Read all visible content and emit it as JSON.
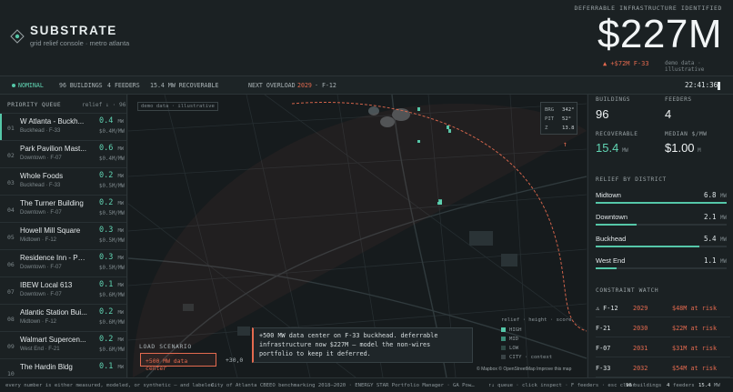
{
  "header": {
    "title": "SUBSTRATE",
    "subtitle": "grid relief console · metro atlanta",
    "hero_label": "DEFERRABLE INFRASTRUCTURE IDENTIFIED",
    "hero_value": "$227M",
    "hero_delta": "▲ +$72M F-33",
    "hero_note": "demo data · illustrative"
  },
  "status": {
    "state": "NOMINAL",
    "buildings": "96 BUILDINGS",
    "feeders": "4 FEEDERS",
    "recoverable": "15.4 MW RECOVERABLE",
    "next_overload_label": "NEXT OVERLOAD",
    "next_overload_year": "2029",
    "next_overload_feeder": "· F-12",
    "clock": "22:41:36"
  },
  "queue": {
    "title": "PRIORITY QUEUE",
    "meta": "relief ↓ · 96",
    "rows": [
      {
        "idx": "01",
        "name": "W Atlanta - Buckh...",
        "sub": "Buckhead · F-33",
        "val": "0.4",
        "unit": "MW",
        "rate": "$0.4M/MW"
      },
      {
        "idx": "02",
        "name": "Park Pavilion Mast...",
        "sub": "Downtown · F-07",
        "val": "0.6",
        "unit": "MW",
        "rate": "$0.4M/MW"
      },
      {
        "idx": "03",
        "name": "Whole Foods",
        "sub": "Buckhead · F-33",
        "val": "0.2",
        "unit": "MW",
        "rate": "$0.5M/MW"
      },
      {
        "idx": "04",
        "name": "The Turner Building",
        "sub": "Downtown · F-07",
        "val": "0.2",
        "unit": "MW",
        "rate": "$0.5M/MW"
      },
      {
        "idx": "05",
        "name": "Howell Mill Square",
        "sub": "Midtown · F-12",
        "val": "0.3",
        "unit": "MW",
        "rate": "$0.5M/MW"
      },
      {
        "idx": "06",
        "name": "Residence Inn - Pe...",
        "sub": "Downtown · F-07",
        "val": "0.3",
        "unit": "MW",
        "rate": "$0.5M/MW"
      },
      {
        "idx": "07",
        "name": "IBEW Local 613",
        "sub": "Downtown · F-07",
        "val": "0.1",
        "unit": "MW",
        "rate": "$0.6M/MW"
      },
      {
        "idx": "08",
        "name": "Atlantic Station Bui...",
        "sub": "Midtown · F-12",
        "val": "0.2",
        "unit": "MW",
        "rate": "$0.6M/MW"
      },
      {
        "idx": "09",
        "name": "Walmart Supercen...",
        "sub": "West End · F-21",
        "val": "0.2",
        "unit": "MW",
        "rate": "$0.6M/MW"
      },
      {
        "idx": "10",
        "name": "The Hardin Bldg",
        "sub": "",
        "val": "0.1",
        "unit": "MW",
        "rate": ""
      }
    ]
  },
  "map": {
    "tag": "demo data · illustrative",
    "orient": [
      {
        "k": "BRG",
        "v": "342°"
      },
      {
        "k": "PIT",
        "v": "52°"
      },
      {
        "k": "Z",
        "v": "13.8"
      }
    ],
    "compass": "↑",
    "scenario_label": "LOAD SCENARIO",
    "scenario_active": "+500 MW data center",
    "scenario_next": "+30,0",
    "toast": "+500 MW data center on F-33 buckhead. deferrable infrastructure now $227M — model the non-wires portfolio to keep it deferred.",
    "legend_title": "relief · height · score",
    "legend": [
      {
        "label": "HIGH",
        "color": "#55c7a8"
      },
      {
        "label": "MID",
        "color": "#3b8c78"
      },
      {
        "label": "LOW",
        "color": "#2f4a45"
      },
      {
        "label": "CITY · context",
        "color": "#3a4346"
      }
    ],
    "credits": "© Mapbox © OpenStreetMap Improve this map"
  },
  "side": {
    "kpis": [
      {
        "label": "BUILDINGS",
        "value": "96",
        "unit": ""
      },
      {
        "label": "FEEDERS",
        "value": "4",
        "unit": ""
      },
      {
        "label": "RECOVERABLE",
        "value": "15.4",
        "unit": "MW"
      },
      {
        "label": "MEDIAN $/MW",
        "value": "$1.00",
        "unit": "M"
      }
    ],
    "district_title": "RELIEF BY DISTRICT",
    "districts": [
      {
        "name": "Midtown",
        "value": "6.8",
        "unit": "MW",
        "fraction": 1.0
      },
      {
        "name": "Downtown",
        "value": "2.1",
        "unit": "MW",
        "fraction": 0.31
      },
      {
        "name": "Buckhead",
        "value": "5.4",
        "unit": "MW",
        "fraction": 0.79
      },
      {
        "name": "West End",
        "value": "1.1",
        "unit": "MW",
        "fraction": 0.16
      }
    ],
    "constraint_title": "CONSTRAINT WATCH",
    "constraints": [
      {
        "feeder": "⚠ F-12",
        "year": "2029",
        "risk": "$48M at risk"
      },
      {
        "feeder": "F-21",
        "year": "2030",
        "risk": "$22M at risk"
      },
      {
        "feeder": "F-07",
        "year": "2031",
        "risk": "$31M at risk"
      },
      {
        "feeder": "F-33",
        "year": "2032",
        "risk": "$54M at risk"
      }
    ]
  },
  "footer": {
    "left": "every number is either measured, modeled, or synthetic — and labeled.",
    "sources": "City of Atlanta CBEEO benchmarking 2018–2020 · ENERGY STAR Portfolio Manager · GA Power large loa...",
    "keys": "↑↓ queue · click inspect · F feeders · esc clear",
    "buildings": "96",
    "buildings_label": "buildings",
    "feeders": "4",
    "feeders_label": "feeders",
    "mw": "15.4",
    "mw_label": "MW"
  },
  "colors": {
    "accent": "#55c7a8",
    "alert": "#e46a4f",
    "background": "#1b2123"
  }
}
